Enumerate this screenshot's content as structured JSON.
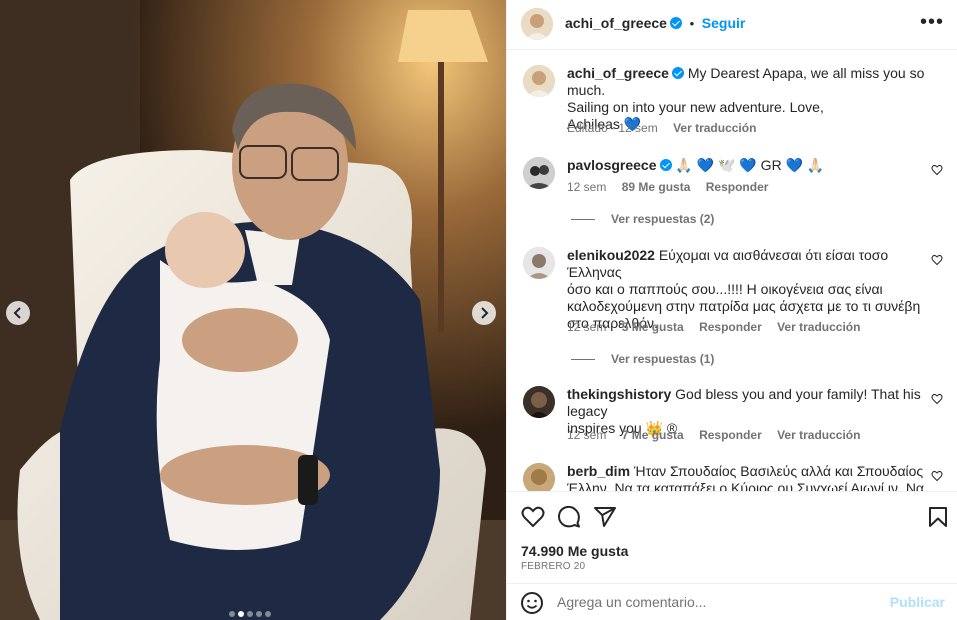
{
  "post": {
    "author": "achi_of_greece",
    "follow_label": "Seguir",
    "more_label": "•••",
    "caption": {
      "username": "achi_of_greece",
      "line1": "My Dearest Apapa, we all miss you so much.",
      "line2": "Sailing on into your new adventure. Love,",
      "line3": "Achileas 💙",
      "edited_label": "Editado · 12 sem",
      "translate_label": "Ver traducción"
    },
    "likes_label": "74.990 Me gusta",
    "date_label": "FEBRERO 20",
    "carousel": {
      "count": 5,
      "active_index": 1
    }
  },
  "comments": [
    {
      "username": "pavlosgreece",
      "verified": true,
      "text": "🙏🏻 💙 🕊️ 💙 GR 💙 🙏🏻",
      "time": "12 sem",
      "likes": "89 Me gusta",
      "reply_label": "Responder",
      "translate_label": "",
      "view_replies": "Ver respuestas (2)"
    },
    {
      "username": "elenikou2022",
      "verified": false,
      "text_line1": "Εύχομαι να αισθάνεσαι ότι είσαι τοσο Έλληνας",
      "text_line2": "όσο και ο παππούς σου...!!!! Η οικογένεια σας είναι",
      "text_line3": "καλοδεχούμενη στην πατρίδα μας άσχετα με το τι συνέβη",
      "text_line4": "στο παρελθόν.",
      "time": "12 sem",
      "likes": "5 Me gusta",
      "reply_label": "Responder",
      "translate_label": "Ver traducción",
      "view_replies": "Ver respuestas (1)"
    },
    {
      "username": "thekingshistory",
      "verified": false,
      "text_line1": "God bless you and your family! That his legacy",
      "text_line2": "inspires you 👑 ®",
      "time": "12 sem",
      "likes": "7 Me gusta",
      "reply_label": "Responder",
      "translate_label": "Ver traducción"
    },
    {
      "username": "berb_dim",
      "verified": false,
      "text_line1": "Ήταν Σπουδαίος Βασιλεύς αλλά και Σπουδαίος",
      "text_line2": "Έλλην. Να τα καταπάξει ο Κύριος ου Συγχωεί Αιωνί ιν. Να"
    }
  ],
  "comment_input": {
    "placeholder": "Agrega un comentario...",
    "post_label": "Publicar"
  },
  "icons": [
    "heart-icon",
    "comment-icon",
    "share-icon",
    "bookmark-icon",
    "emoji-icon",
    "chevron-left-icon",
    "chevron-right-icon",
    "more-icon",
    "verified-icon"
  ]
}
